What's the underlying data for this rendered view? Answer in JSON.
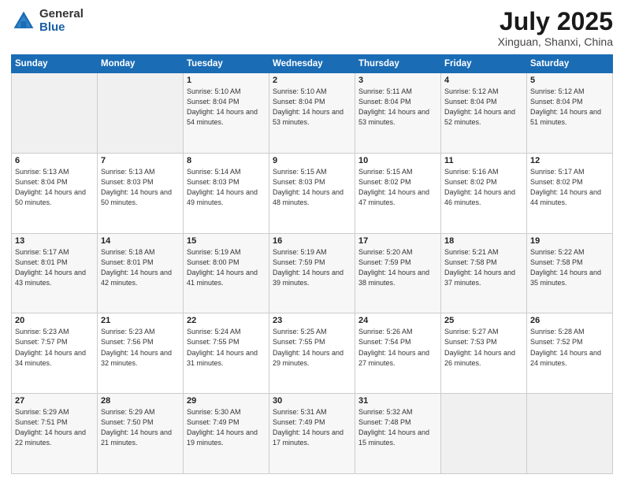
{
  "header": {
    "logo_general": "General",
    "logo_blue": "Blue",
    "title": "July 2025",
    "location": "Xinguan, Shanxi, China"
  },
  "days_of_week": [
    "Sunday",
    "Monday",
    "Tuesday",
    "Wednesday",
    "Thursday",
    "Friday",
    "Saturday"
  ],
  "weeks": [
    [
      {
        "day": "",
        "sunrise": "",
        "sunset": "",
        "daylight": ""
      },
      {
        "day": "",
        "sunrise": "",
        "sunset": "",
        "daylight": ""
      },
      {
        "day": "1",
        "sunrise": "Sunrise: 5:10 AM",
        "sunset": "Sunset: 8:04 PM",
        "daylight": "Daylight: 14 hours and 54 minutes."
      },
      {
        "day": "2",
        "sunrise": "Sunrise: 5:10 AM",
        "sunset": "Sunset: 8:04 PM",
        "daylight": "Daylight: 14 hours and 53 minutes."
      },
      {
        "day": "3",
        "sunrise": "Sunrise: 5:11 AM",
        "sunset": "Sunset: 8:04 PM",
        "daylight": "Daylight: 14 hours and 53 minutes."
      },
      {
        "day": "4",
        "sunrise": "Sunrise: 5:12 AM",
        "sunset": "Sunset: 8:04 PM",
        "daylight": "Daylight: 14 hours and 52 minutes."
      },
      {
        "day": "5",
        "sunrise": "Sunrise: 5:12 AM",
        "sunset": "Sunset: 8:04 PM",
        "daylight": "Daylight: 14 hours and 51 minutes."
      }
    ],
    [
      {
        "day": "6",
        "sunrise": "Sunrise: 5:13 AM",
        "sunset": "Sunset: 8:04 PM",
        "daylight": "Daylight: 14 hours and 50 minutes."
      },
      {
        "day": "7",
        "sunrise": "Sunrise: 5:13 AM",
        "sunset": "Sunset: 8:03 PM",
        "daylight": "Daylight: 14 hours and 50 minutes."
      },
      {
        "day": "8",
        "sunrise": "Sunrise: 5:14 AM",
        "sunset": "Sunset: 8:03 PM",
        "daylight": "Daylight: 14 hours and 49 minutes."
      },
      {
        "day": "9",
        "sunrise": "Sunrise: 5:15 AM",
        "sunset": "Sunset: 8:03 PM",
        "daylight": "Daylight: 14 hours and 48 minutes."
      },
      {
        "day": "10",
        "sunrise": "Sunrise: 5:15 AM",
        "sunset": "Sunset: 8:02 PM",
        "daylight": "Daylight: 14 hours and 47 minutes."
      },
      {
        "day": "11",
        "sunrise": "Sunrise: 5:16 AM",
        "sunset": "Sunset: 8:02 PM",
        "daylight": "Daylight: 14 hours and 46 minutes."
      },
      {
        "day": "12",
        "sunrise": "Sunrise: 5:17 AM",
        "sunset": "Sunset: 8:02 PM",
        "daylight": "Daylight: 14 hours and 44 minutes."
      }
    ],
    [
      {
        "day": "13",
        "sunrise": "Sunrise: 5:17 AM",
        "sunset": "Sunset: 8:01 PM",
        "daylight": "Daylight: 14 hours and 43 minutes."
      },
      {
        "day": "14",
        "sunrise": "Sunrise: 5:18 AM",
        "sunset": "Sunset: 8:01 PM",
        "daylight": "Daylight: 14 hours and 42 minutes."
      },
      {
        "day": "15",
        "sunrise": "Sunrise: 5:19 AM",
        "sunset": "Sunset: 8:00 PM",
        "daylight": "Daylight: 14 hours and 41 minutes."
      },
      {
        "day": "16",
        "sunrise": "Sunrise: 5:19 AM",
        "sunset": "Sunset: 7:59 PM",
        "daylight": "Daylight: 14 hours and 39 minutes."
      },
      {
        "day": "17",
        "sunrise": "Sunrise: 5:20 AM",
        "sunset": "Sunset: 7:59 PM",
        "daylight": "Daylight: 14 hours and 38 minutes."
      },
      {
        "day": "18",
        "sunrise": "Sunrise: 5:21 AM",
        "sunset": "Sunset: 7:58 PM",
        "daylight": "Daylight: 14 hours and 37 minutes."
      },
      {
        "day": "19",
        "sunrise": "Sunrise: 5:22 AM",
        "sunset": "Sunset: 7:58 PM",
        "daylight": "Daylight: 14 hours and 35 minutes."
      }
    ],
    [
      {
        "day": "20",
        "sunrise": "Sunrise: 5:23 AM",
        "sunset": "Sunset: 7:57 PM",
        "daylight": "Daylight: 14 hours and 34 minutes."
      },
      {
        "day": "21",
        "sunrise": "Sunrise: 5:23 AM",
        "sunset": "Sunset: 7:56 PM",
        "daylight": "Daylight: 14 hours and 32 minutes."
      },
      {
        "day": "22",
        "sunrise": "Sunrise: 5:24 AM",
        "sunset": "Sunset: 7:55 PM",
        "daylight": "Daylight: 14 hours and 31 minutes."
      },
      {
        "day": "23",
        "sunrise": "Sunrise: 5:25 AM",
        "sunset": "Sunset: 7:55 PM",
        "daylight": "Daylight: 14 hours and 29 minutes."
      },
      {
        "day": "24",
        "sunrise": "Sunrise: 5:26 AM",
        "sunset": "Sunset: 7:54 PM",
        "daylight": "Daylight: 14 hours and 27 minutes."
      },
      {
        "day": "25",
        "sunrise": "Sunrise: 5:27 AM",
        "sunset": "Sunset: 7:53 PM",
        "daylight": "Daylight: 14 hours and 26 minutes."
      },
      {
        "day": "26",
        "sunrise": "Sunrise: 5:28 AM",
        "sunset": "Sunset: 7:52 PM",
        "daylight": "Daylight: 14 hours and 24 minutes."
      }
    ],
    [
      {
        "day": "27",
        "sunrise": "Sunrise: 5:29 AM",
        "sunset": "Sunset: 7:51 PM",
        "daylight": "Daylight: 14 hours and 22 minutes."
      },
      {
        "day": "28",
        "sunrise": "Sunrise: 5:29 AM",
        "sunset": "Sunset: 7:50 PM",
        "daylight": "Daylight: 14 hours and 21 minutes."
      },
      {
        "day": "29",
        "sunrise": "Sunrise: 5:30 AM",
        "sunset": "Sunset: 7:49 PM",
        "daylight": "Daylight: 14 hours and 19 minutes."
      },
      {
        "day": "30",
        "sunrise": "Sunrise: 5:31 AM",
        "sunset": "Sunset: 7:49 PM",
        "daylight": "Daylight: 14 hours and 17 minutes."
      },
      {
        "day": "31",
        "sunrise": "Sunrise: 5:32 AM",
        "sunset": "Sunset: 7:48 PM",
        "daylight": "Daylight: 14 hours and 15 minutes."
      },
      {
        "day": "",
        "sunrise": "",
        "sunset": "",
        "daylight": ""
      },
      {
        "day": "",
        "sunrise": "",
        "sunset": "",
        "daylight": ""
      }
    ]
  ]
}
